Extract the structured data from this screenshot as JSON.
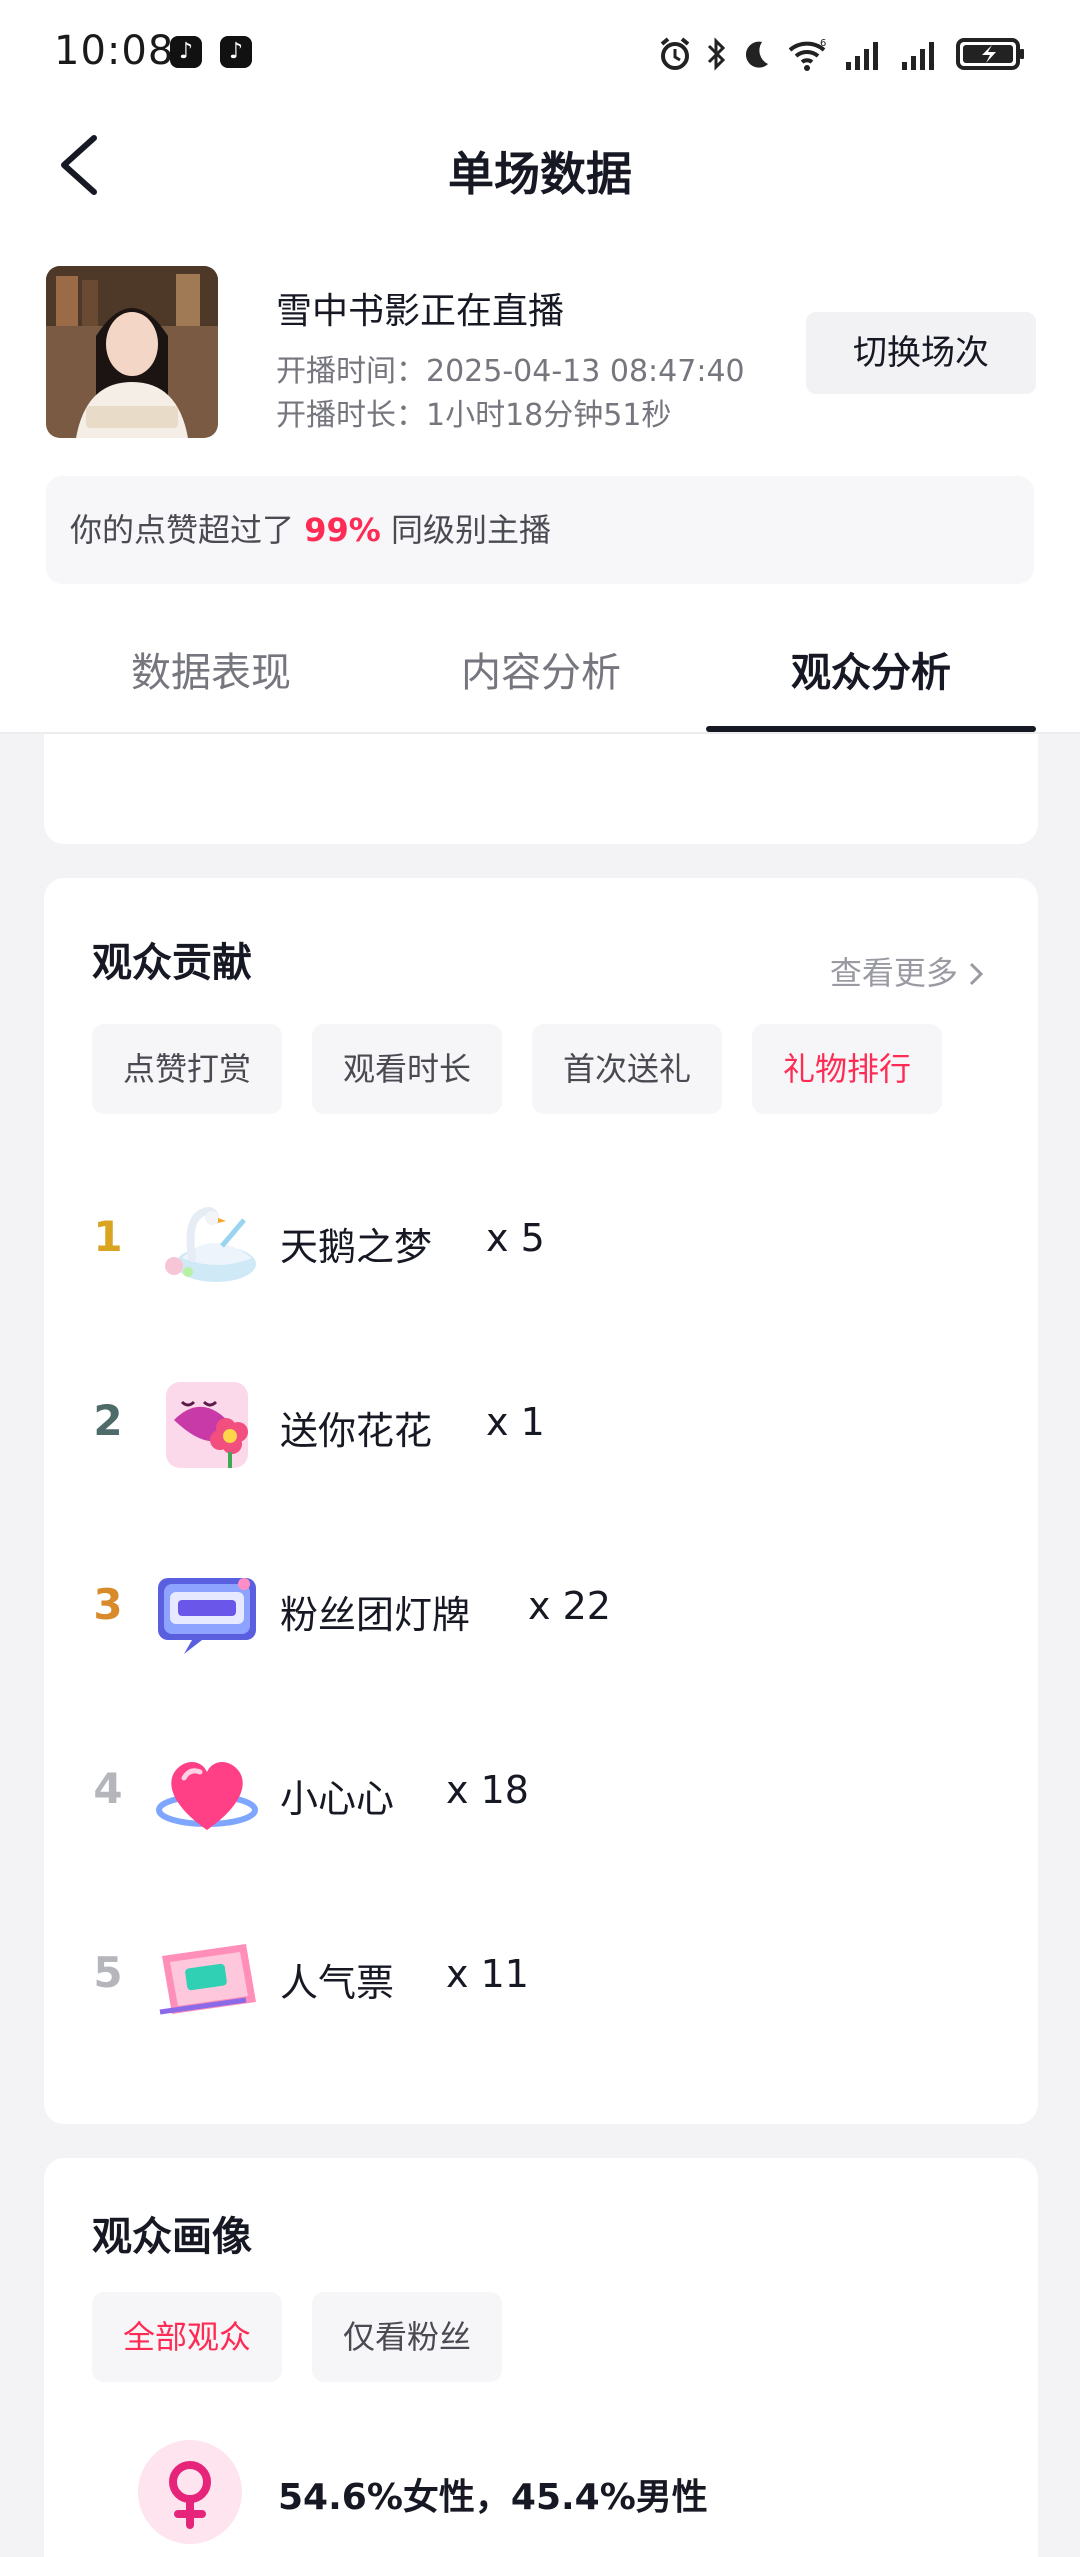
{
  "status_bar": {
    "time": "10:08",
    "app_badges": [
      "tiktok-icon",
      "tiktok-icon"
    ],
    "indicators": [
      "alarm-icon",
      "bluetooth-icon",
      "moon-icon",
      "wifi-icon",
      "signal-icon",
      "signal-icon",
      "battery-charging-icon"
    ],
    "wifi_label": "6"
  },
  "header": {
    "title": "单场数据",
    "back_icon": "chevron-left-icon"
  },
  "live": {
    "title": "雪中书影正在直播",
    "start_time": "开播时间：2025-04-13 08:47:40",
    "duration": "开播时长：1小时18分钟51秒",
    "switch_label": "切换场次"
  },
  "banner": {
    "prefix": "你的点赞超过了 ",
    "highlight": "99%",
    "suffix": " 同级别主播"
  },
  "tabs": [
    {
      "label": "数据表现",
      "active": false
    },
    {
      "label": "内容分析",
      "active": false
    },
    {
      "label": "观众分析",
      "active": true
    }
  ],
  "contribution": {
    "title": "观众贡献",
    "see_more": "查看更多",
    "filters": [
      {
        "label": "点赞打赏",
        "active": false
      },
      {
        "label": "观看时长",
        "active": false
      },
      {
        "label": "首次送礼",
        "active": false
      },
      {
        "label": "礼物排行",
        "active": true
      }
    ],
    "gifts": [
      {
        "rank": "1",
        "name": "天鹅之梦",
        "count": "x 5",
        "icon": "swan-gift-icon",
        "rank_color": "#d9a521"
      },
      {
        "rank": "2",
        "name": "送你花花",
        "count": "x 1",
        "icon": "flower-gift-icon",
        "rank_color": "#4d6b68"
      },
      {
        "rank": "3",
        "name": "粉丝团灯牌",
        "count": "x 22",
        "icon": "fan-club-sign-gift-icon",
        "rank_color": "#d98a2b"
      },
      {
        "rank": "4",
        "name": "小心心",
        "count": "x 18",
        "icon": "heart-gift-icon",
        "rank_color": "#b5b6bc"
      },
      {
        "rank": "5",
        "name": "人气票",
        "count": "x 11",
        "icon": "popularity-ticket-gift-icon",
        "rank_color": "#b5b6bc"
      }
    ]
  },
  "portrait": {
    "title": "观众画像",
    "filters": [
      {
        "label": "全部观众",
        "active": true
      },
      {
        "label": "仅看粉丝",
        "active": false
      }
    ],
    "gender_icon": "female-icon",
    "gender_text": "54.6%女性，45.4%男性"
  },
  "colors": {
    "accent": "#fe2c55",
    "text_primary": "#161823",
    "text_secondary": "#75767e",
    "page_bg": "#f3f3f5"
  }
}
